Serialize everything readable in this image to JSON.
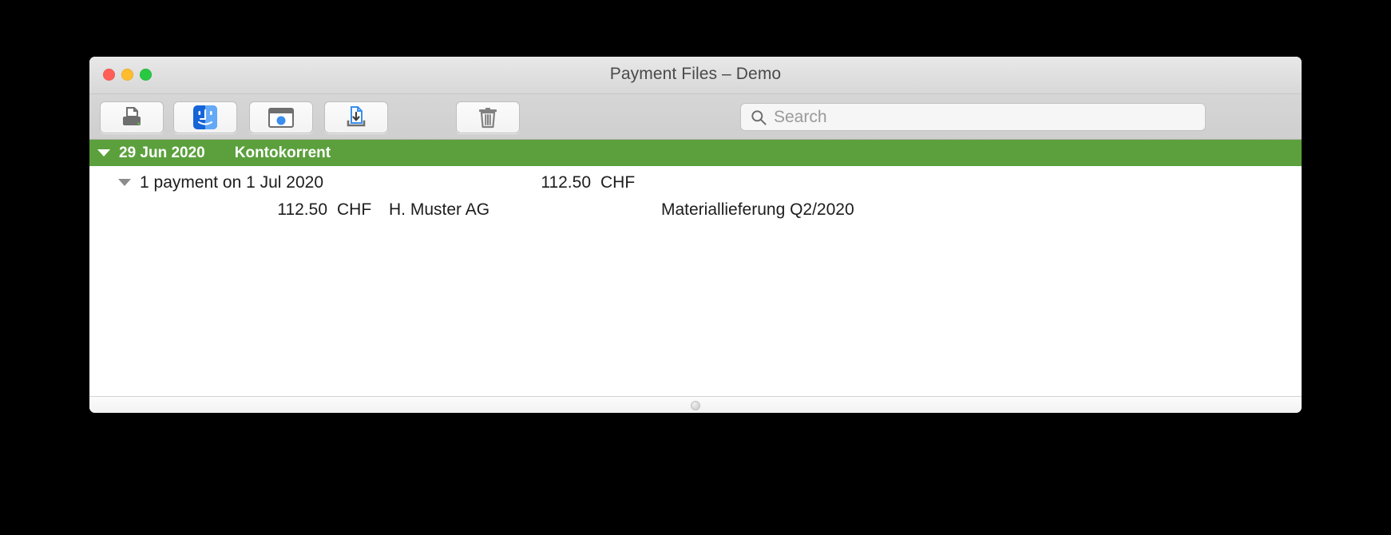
{
  "window": {
    "title": "Payment Files – Demo",
    "controls": {
      "close": "close-button",
      "minimize": "minimize-button",
      "maximize": "maximize-button"
    }
  },
  "toolbar": {
    "buttons": [
      {
        "name": "print-button",
        "icon": "printer-icon"
      },
      {
        "name": "finder-button",
        "icon": "finder-icon"
      },
      {
        "name": "preview-button",
        "icon": "preview-window-icon"
      },
      {
        "name": "import-button",
        "icon": "document-download-icon"
      },
      {
        "name": "delete-button",
        "icon": "trash-icon"
      }
    ]
  },
  "search": {
    "placeholder": "Search",
    "value": "",
    "icon": "search-icon"
  },
  "list": {
    "group": {
      "expanded": true,
      "date": "29 Jun 2020",
      "account": "Kontokorrent",
      "accent_color": "#5ba03c"
    },
    "payment": {
      "expanded": true,
      "label": "1 payment on 1 Jul 2020",
      "amount": "112.50",
      "currency": "CHF"
    },
    "detail": {
      "amount": "112.50",
      "currency": "CHF",
      "recipient": "H. Muster AG",
      "note": "Materiallieferung Q2/2020"
    }
  },
  "footer": {
    "grip": "resize-grip"
  }
}
